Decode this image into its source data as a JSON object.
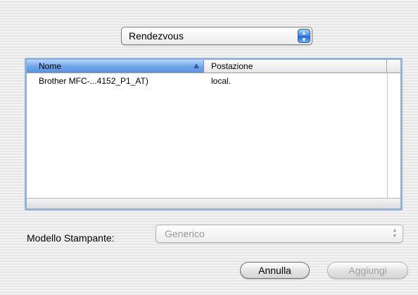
{
  "source_popup": {
    "selected": "Rendezvous"
  },
  "list": {
    "columns": [
      "Nome",
      "Postazione"
    ],
    "rows": [
      {
        "name": "Brother MFC-...4152_P1_AT)",
        "location": "local."
      }
    ]
  },
  "model": {
    "label": "Modello Stampante:",
    "selected": "Generico"
  },
  "buttons": {
    "cancel": "Annulla",
    "add": "Aggiungi"
  },
  "colors": {
    "accent": "#5a93e3",
    "list_border": "#8fb3de"
  }
}
